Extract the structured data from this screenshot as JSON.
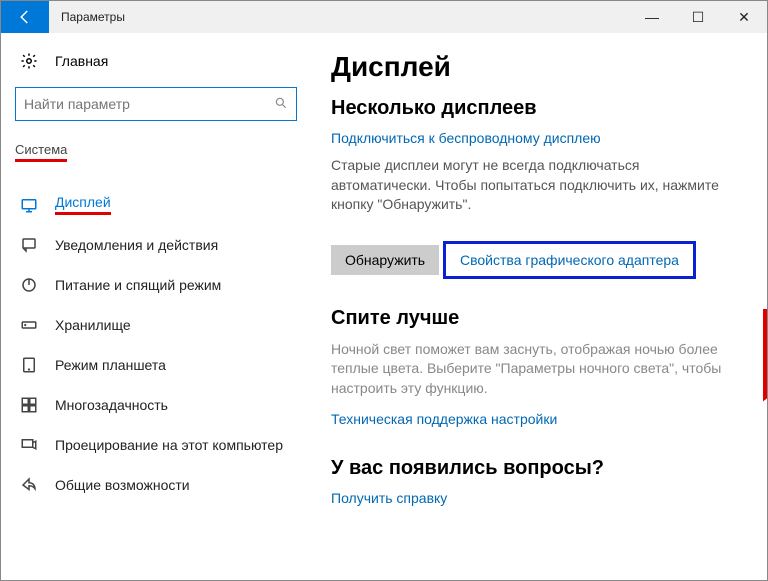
{
  "titlebar": {
    "title": "Параметры",
    "minimize": "—",
    "maximize": "☐",
    "close": "✕"
  },
  "left": {
    "home": "Главная",
    "search_placeholder": "Найти параметр",
    "section": "Система",
    "nav": [
      {
        "label": "Дисплей"
      },
      {
        "label": "Уведомления и действия"
      },
      {
        "label": "Питание и спящий режим"
      },
      {
        "label": "Хранилище"
      },
      {
        "label": "Режим планшета"
      },
      {
        "label": "Многозадачность"
      },
      {
        "label": "Проецирование на этот компьютер"
      },
      {
        "label": "Общие возможности"
      }
    ]
  },
  "right": {
    "h1": "Дисплей",
    "multi_h2": "Несколько дисплеев",
    "wireless_link": "Подключиться к беспроводному дисплею",
    "old_displays_text": "Старые дисплеи могут не всегда подключаться автоматически. Чтобы попытаться подключить их, нажмите кнопку \"Обнаружить\".",
    "detect_btn": "Обнаружить",
    "adapter_link": "Свойства графического адаптера",
    "sleep_h2": "Спите лучше",
    "sleep_text": "Ночной свет поможет вам заснуть, отображая ночью более теплые цвета. Выберите \"Параметры ночного света\", чтобы настроить эту функцию.",
    "tech_support_link": "Техническая поддержка настройки",
    "questions_h2": "У вас появились вопросы?",
    "help_link": "Получить справку"
  }
}
